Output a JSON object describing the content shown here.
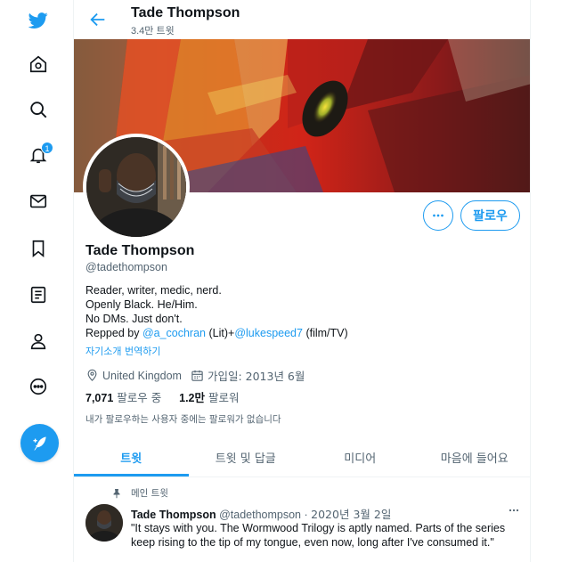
{
  "nav": {
    "items": [
      {
        "name": "twitter-logo-icon"
      },
      {
        "name": "home-icon"
      },
      {
        "name": "explore-icon"
      },
      {
        "name": "notifications-icon",
        "badge": "1"
      },
      {
        "name": "messages-icon"
      },
      {
        "name": "bookmarks-icon"
      },
      {
        "name": "lists-icon"
      },
      {
        "name": "profile-icon"
      },
      {
        "name": "more-icon"
      }
    ],
    "tweet_button_icon": "compose-feather-icon"
  },
  "header": {
    "name": "Tade Thompson",
    "tweet_count": "3.4만 트윗"
  },
  "profile": {
    "follow_label": "팔로우",
    "name": "Tade Thompson",
    "handle": "@tadethompson",
    "bio_line1": "Reader, writer, medic, nerd.",
    "bio_line2": "Openly Black. He/Him.",
    "bio_line3": "No DMs. Just don't.",
    "bio_repped_prefix": "Repped by ",
    "bio_link1": "@a_cochran",
    "bio_mid": " (Lit)+",
    "bio_link2": "@lukespeed7",
    "bio_suffix": " (film/TV)",
    "translate_label": "자기소개 번역하기",
    "location": "United Kingdom",
    "joined": "가입일: 2013년 6월",
    "following_count": "7,071",
    "following_label": "팔로우 중",
    "followers_count": "1.2만",
    "followers_label": "팔로워",
    "followers_you_know": "내가 팔로우하는 사용자 중에는 팔로워가 없습니다"
  },
  "tabs": [
    {
      "label": "트윗",
      "active": true
    },
    {
      "label": "트윗 및 답글",
      "active": false
    },
    {
      "label": "미디어",
      "active": false
    },
    {
      "label": "마음에 들어요",
      "active": false
    }
  ],
  "pinned_tweet": {
    "pinned_label": "메인 트윗",
    "author_name": "Tade Thompson",
    "author_handle": "@tadethompson",
    "separator": "·",
    "date": "2020년 3월 2일",
    "text": "\"It stays with you. The Wormwood Trilogy is aptly named. Parts of the series keep rising to the tip of my tongue, even now, long after I've consumed it.\""
  },
  "colors": {
    "accent": "#1d9bf0",
    "text": "#0f1419",
    "secondary": "#536471"
  }
}
